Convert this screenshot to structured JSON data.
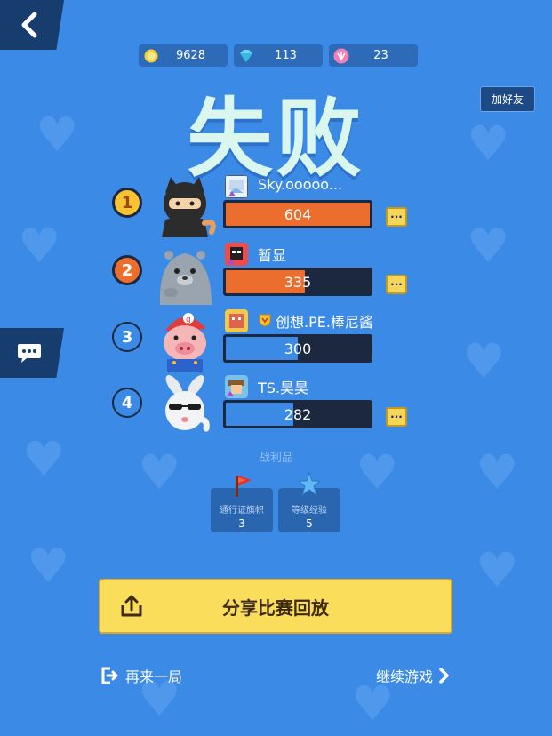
{
  "currencies": [
    {
      "icon": "gold-coin-icon",
      "value": "9628"
    },
    {
      "icon": "diamond-icon",
      "value": "113"
    },
    {
      "icon": "pink-crystal-icon",
      "value": "23"
    }
  ],
  "title": "失败",
  "add_friend_label": "加好友",
  "players": [
    {
      "rank": "1",
      "name": "Sky.ooooo...",
      "score": "604",
      "score_fraction": 1.0,
      "bar_color": "#ec6e2e",
      "has_more": true
    },
    {
      "rank": "2",
      "name": "暂显",
      "score": "335",
      "score_fraction": 0.55,
      "bar_color": "#ec6e2e",
      "has_more": true
    },
    {
      "rank": "3",
      "name": "创想.PE.棒尼酱",
      "score": "300",
      "score_fraction": 0.5,
      "bar_color": "#3b8ae6",
      "has_more": false
    },
    {
      "rank": "4",
      "name": "TS.昊昊",
      "score": "282",
      "score_fraction": 0.47,
      "bar_color": "#3b8ae6",
      "has_more": true
    }
  ],
  "more_label": "···",
  "loot": {
    "title": "战利品",
    "items": [
      {
        "label": "通行证旗帜",
        "count": "3",
        "icon": "red-flag-icon"
      },
      {
        "label": "等级经验",
        "count": "5",
        "icon": "blue-star-icon"
      }
    ]
  },
  "share_button_label": "分享比赛回放",
  "play_again_label": "再来一局",
  "continue_label": "继续游戏",
  "colors": {
    "background": "#3b8ae6",
    "title": "#d9f7ef",
    "share_button": "#f9dd5b",
    "orange_bar": "#ec6e2e",
    "blue_bar": "#3b8ae6"
  }
}
